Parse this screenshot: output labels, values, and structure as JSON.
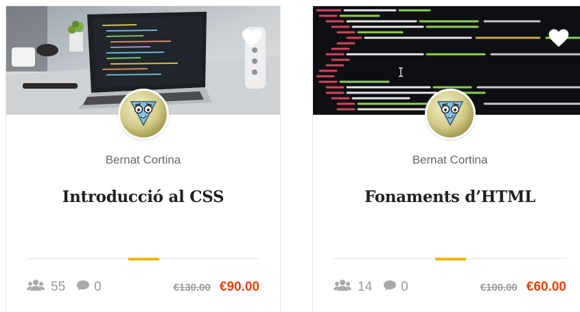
{
  "courses": [
    {
      "author": "Bernat Cortina",
      "title": "Introducció al CSS",
      "students": "55",
      "comments": "0",
      "original_price": "€130.00",
      "sale_price": "€90.00"
    },
    {
      "author": "Bernat Cortina",
      "title": "Fonaments d’HTML",
      "students": "14",
      "comments": "0",
      "original_price": "€100.00",
      "sale_price": "€60.00"
    }
  ],
  "icons": {
    "favorite": "heart-icon",
    "students": "users-icon",
    "comments": "comment-icon"
  },
  "colors": {
    "accent": "#f3b300",
    "sale_price": "#e8430c",
    "meta_text": "#999999"
  }
}
